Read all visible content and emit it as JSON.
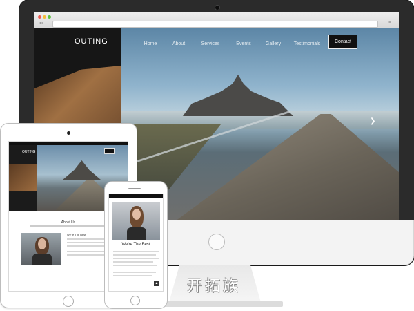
{
  "desktop": {
    "logo": "OUTING",
    "nav": [
      "Home",
      "About",
      "Services",
      "Events",
      "Gallery",
      "Testimonials",
      "Contact"
    ],
    "slider_next_icon": "chevron-right-icon"
  },
  "tablet": {
    "logo": "OUTING",
    "section_title": "About Us",
    "feature_title": "We're The Best"
  },
  "phone": {
    "feature_title": "We're The Best",
    "scroll_top_icon": "arrow-up-icon"
  },
  "watermark": "开拓族",
  "colors": {
    "device_frame": "#2b2b2b",
    "contact_button": "#111111",
    "nav_text": "#e8eef2"
  }
}
